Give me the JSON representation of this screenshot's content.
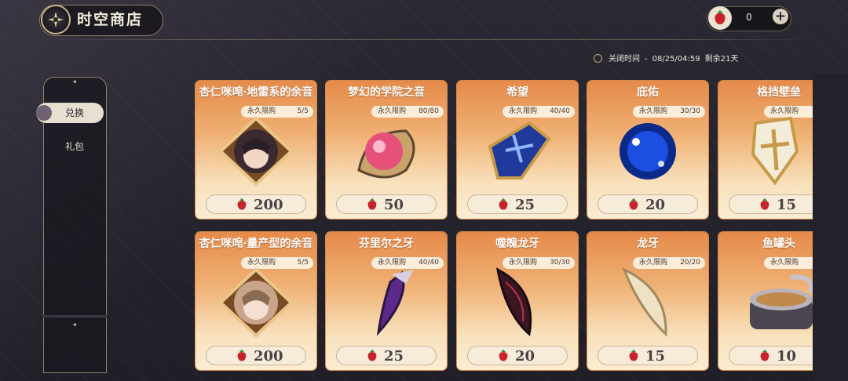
{
  "header": {
    "title": "时空商店"
  },
  "currency": {
    "value": "0",
    "plus": "+"
  },
  "close": {
    "label": "关闭时间",
    "dash": "-",
    "datetime": "08/25/04:59",
    "remaining": "剩余21天"
  },
  "sidebar": {
    "tabs": [
      {
        "label": "兑换",
        "active": true
      },
      {
        "label": "礼包",
        "active": false
      }
    ]
  },
  "limit_label": "永久限购",
  "items": [
    {
      "name": "杏仁咪唣·地雷系的余音",
      "limit": "5/5",
      "price": "200",
      "icon": "character-portrait-icon"
    },
    {
      "name": "梦幻的学院之音",
      "limit": "80/80",
      "price": "50",
      "icon": "pink-orb-icon"
    },
    {
      "name": "希望",
      "limit": "40/40",
      "price": "25",
      "icon": "blue-shield-icon"
    },
    {
      "name": "庇佑",
      "limit": "30/30",
      "price": "20",
      "icon": "blue-orb-icon"
    },
    {
      "name": "格挡壁垒",
      "limit": "",
      "price": "15",
      "icon": "white-shield-icon"
    },
    {
      "name": "杏仁咪唣·量产型的余音",
      "limit": "5/5",
      "price": "200",
      "icon": "character-portrait-icon"
    },
    {
      "name": "芬里尔之牙",
      "limit": "40/40",
      "price": "25",
      "icon": "purple-fang-icon"
    },
    {
      "name": "噬魄龙牙",
      "limit": "30/30",
      "price": "20",
      "icon": "dark-fang-icon"
    },
    {
      "name": "龙牙",
      "limit": "20/20",
      "price": "15",
      "icon": "bone-fang-icon"
    },
    {
      "name": "鱼罐头",
      "limit": "",
      "price": "10",
      "icon": "fish-can-icon"
    }
  ],
  "colors": {
    "accent": "#e58a4a",
    "price_text": "#4a4246",
    "bg": "#24222c"
  }
}
